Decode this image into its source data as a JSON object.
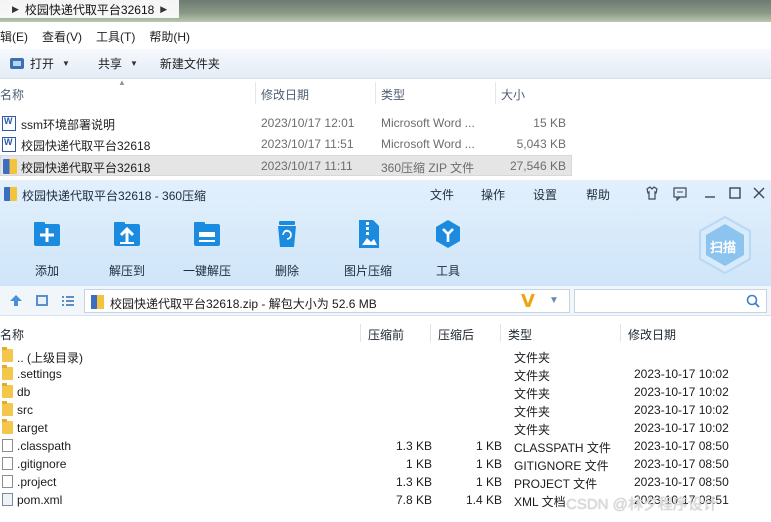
{
  "explorer": {
    "breadcrumb": "校园快递代取平台32618",
    "menu": [
      "编辑(E)",
      "查看(V)",
      "工具(T)",
      "帮助(H)"
    ],
    "toolbar": {
      "open": "打开",
      "share": "共享",
      "new_folder": "新建文件夹"
    },
    "columns": {
      "name": "名称",
      "modified": "修改日期",
      "type": "类型",
      "size": "大小"
    },
    "files": [
      {
        "name": "ssm环境部署说明",
        "modified": "2023/10/17 12:01",
        "type": "Microsoft Word ...",
        "size": "15 KB",
        "icon": "word-doc-icon"
      },
      {
        "name": "校园快递代取平台32618",
        "modified": "2023/10/17 11:51",
        "type": "Microsoft Word ...",
        "size": "5,043 KB",
        "icon": "word-doc-icon"
      },
      {
        "name": "校园快递代取平台32618",
        "modified": "2023/10/17 11:11",
        "type": "360压缩 ZIP 文件",
        "size": "27,546 KB",
        "icon": "zip-archive-icon"
      }
    ]
  },
  "zip": {
    "title": "校园快递代取平台32618 - 360压缩",
    "menu": [
      "文件",
      "操作",
      "设置",
      "帮助"
    ],
    "tools": [
      "添加",
      "解压到",
      "一键解压",
      "删除",
      "图片压缩",
      "工具"
    ],
    "scan": "扫描",
    "path": "校园快递代取平台32618.zip - 解包大小为 52.6 MB",
    "columns": {
      "name": "名称",
      "before": "压缩前",
      "after": "压缩后",
      "type": "类型",
      "modified": "修改日期"
    },
    "rows": [
      {
        "name": ".. (上级目录)",
        "before": "",
        "after": "",
        "type": "文件夹",
        "modified": "",
        "icon": "folder-icon"
      },
      {
        "name": ".settings",
        "before": "",
        "after": "",
        "type": "文件夹",
        "modified": "2023-10-17 10:02",
        "icon": "folder-icon"
      },
      {
        "name": "db",
        "before": "",
        "after": "",
        "type": "文件夹",
        "modified": "2023-10-17 10:02",
        "icon": "folder-icon"
      },
      {
        "name": "src",
        "before": "",
        "after": "",
        "type": "文件夹",
        "modified": "2023-10-17 10:02",
        "icon": "folder-icon"
      },
      {
        "name": "target",
        "before": "",
        "after": "",
        "type": "文件夹",
        "modified": "2023-10-17 10:02",
        "icon": "folder-icon"
      },
      {
        "name": ".classpath",
        "before": "1.3 KB",
        "after": "1 KB",
        "type": "CLASSPATH 文件",
        "modified": "2023-10-17 08:50",
        "icon": "file-icon"
      },
      {
        "name": ".gitignore",
        "before": "1 KB",
        "after": "1 KB",
        "type": "GITIGNORE 文件",
        "modified": "2023-10-17 08:50",
        "icon": "file-icon"
      },
      {
        "name": ".project",
        "before": "1.3 KB",
        "after": "1 KB",
        "type": "PROJECT 文件",
        "modified": "2023-10-17 08:50",
        "icon": "file-icon"
      },
      {
        "name": "pom.xml",
        "before": "7.8 KB",
        "after": "1.4 KB",
        "type": "XML 文档",
        "modified": "2023-10-17 08:51",
        "icon": "xml-file-icon"
      }
    ]
  },
  "watermark": "CSDN @林夕程序设计",
  "colors": {
    "zip_header_top": "#e2f0fc",
    "zip_header_bottom": "#cfe5f9",
    "tool_blue": "#1b8be0",
    "folder_yellow": "#f3c74b",
    "selection_gray": "#e5e5e5"
  }
}
